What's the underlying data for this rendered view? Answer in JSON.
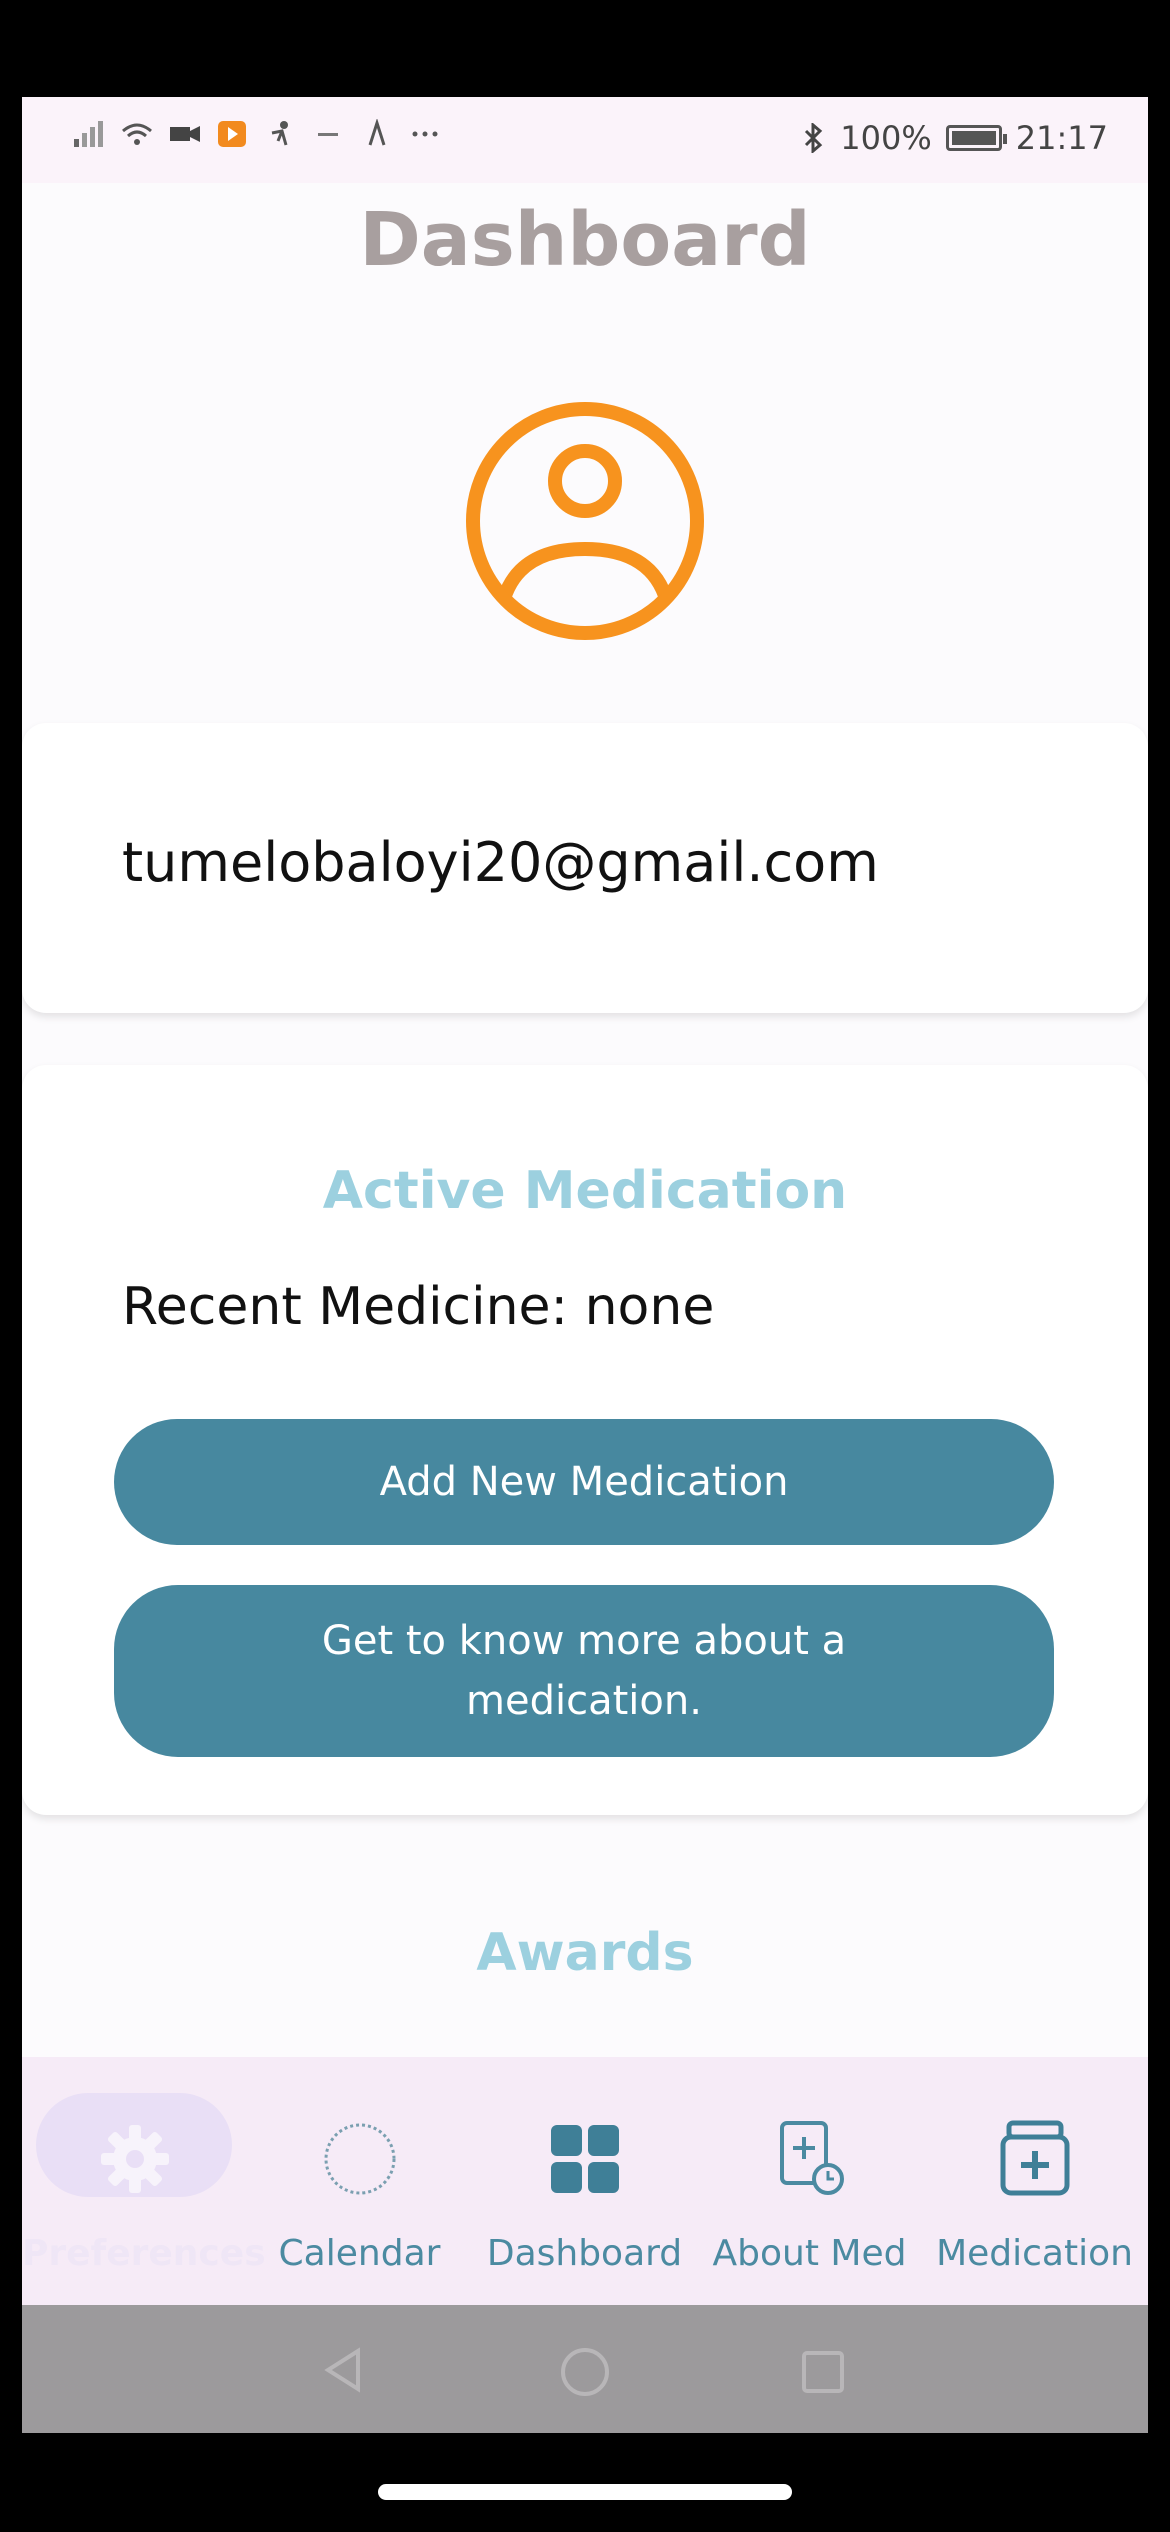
{
  "status_bar": {
    "battery": "100%",
    "time": "21:17"
  },
  "page": {
    "title": "Dashboard"
  },
  "profile": {
    "email": "tumelobaloyi20@gmail.com"
  },
  "active_medication": {
    "title": "Active Medication",
    "recent": "Recent Medicine: none",
    "add_button": "Add New Medication",
    "learn_button": "Get to know more about a medication."
  },
  "awards": {
    "title": "Awards"
  },
  "bottom_nav": {
    "items": [
      {
        "label": "Preferences",
        "icon": "gear-icon"
      },
      {
        "label": "Calendar",
        "icon": "calendar-icon"
      },
      {
        "label": "Dashboard",
        "icon": "dashboard-icon"
      },
      {
        "label": "About Med",
        "icon": "about-med-icon"
      },
      {
        "label": "Medication",
        "icon": "medication-icon"
      }
    ],
    "selected": "Preferences"
  },
  "colors": {
    "accent_orange": "#f7931e",
    "button_teal": "#47889f",
    "section_title": "#9cd0df",
    "nav_bg": "#f6ebf7"
  }
}
